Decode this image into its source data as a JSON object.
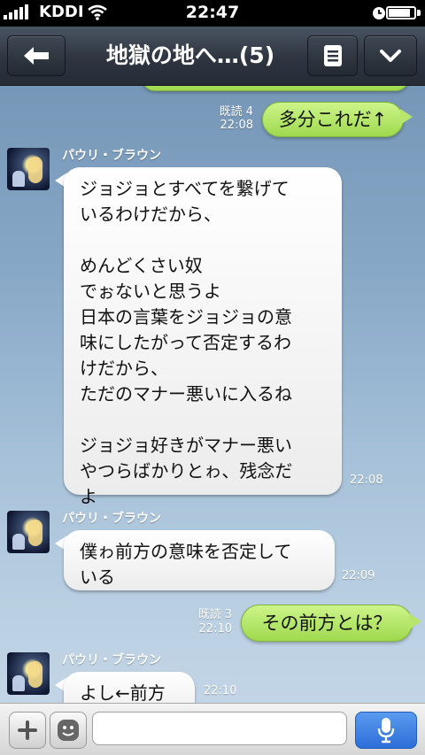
{
  "status_bar": {
    "carrier": "KDDI",
    "time": "22:47",
    "battery_level": 0.85
  },
  "header": {
    "title": "地獄の地へ…(5)"
  },
  "messages": [
    {
      "side": "right",
      "read": "既読 4",
      "time": "22:08",
      "text": "多分これだ↑"
    },
    {
      "side": "left",
      "sender": "パウリ・ブラウン",
      "time": "22:08",
      "text": "ジョジョとすべてを繋げて\nいるわけだから、\n\nめんどくさい奴\nでぉないと思うよ\n日本の言葉をジョジョの意\n味にしたがって否定するわ\nけだから、\nただのマナー悪いに入るね\n\nジョジョ好きがマナー悪い\nやつらばかりとゎ、残念だ\nよ"
    },
    {
      "side": "left",
      "sender": "パウリ・ブラウン",
      "time": "22:09",
      "text": "僕ゎ前方の意味を否定して\nいる"
    },
    {
      "side": "right",
      "read": "既読 3",
      "time": "22:10",
      "text": "その前方とは？"
    },
    {
      "side": "left",
      "sender": "パウリ・ブラウン",
      "time": "22:10",
      "text": "よし←前方"
    }
  ],
  "input": {
    "placeholder": ""
  },
  "colors": {
    "nav_bg": "#2e3540",
    "bubble_green": "#b8e66c",
    "send_blue": "#2c6ed8"
  }
}
